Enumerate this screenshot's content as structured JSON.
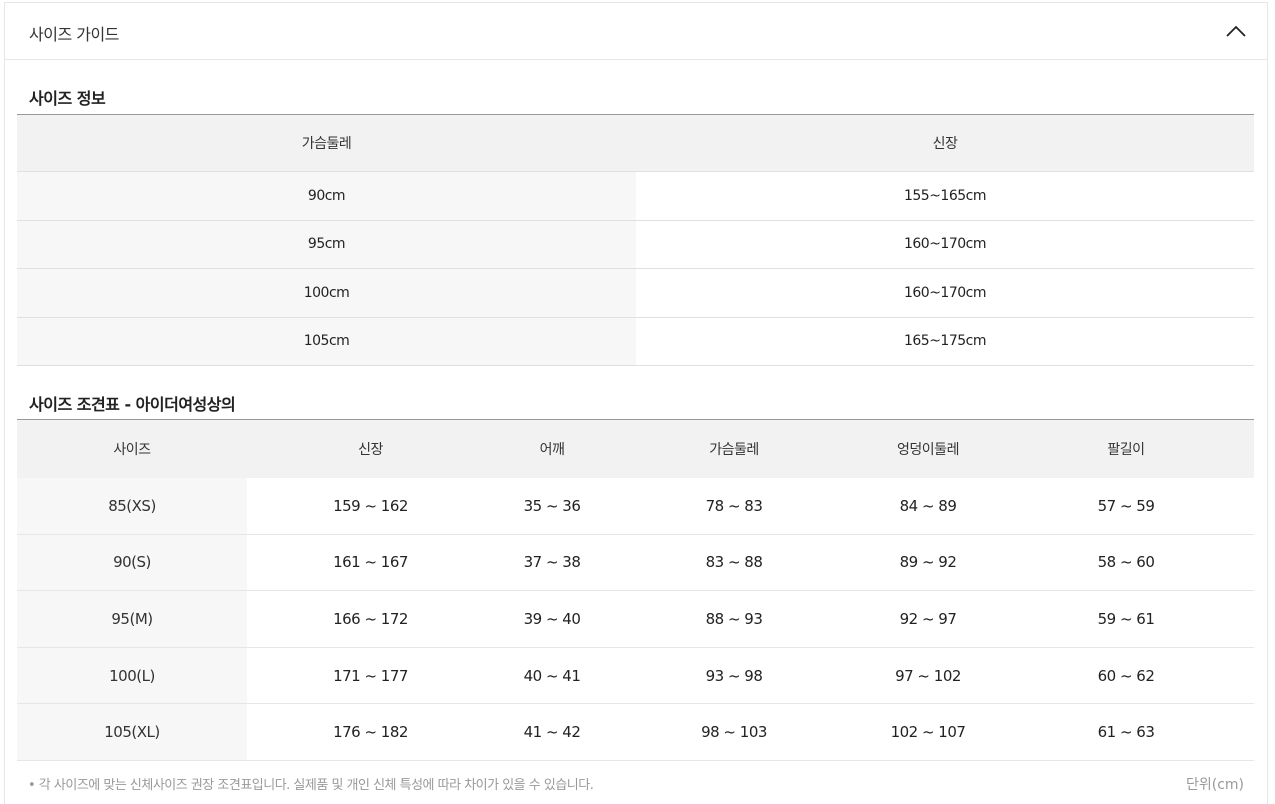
{
  "accordion": {
    "title": "사이즈 가이드"
  },
  "size_info": {
    "title": "사이즈 정보",
    "headers": [
      "가슴둘레",
      "신장"
    ],
    "rows": [
      [
        "90cm",
        "155~165cm"
      ],
      [
        "95cm",
        "160~170cm"
      ],
      [
        "100cm",
        "160~170cm"
      ],
      [
        "105cm",
        "165~175cm"
      ]
    ]
  },
  "size_chart": {
    "title": "사이즈 조견표 - 아이더여성상의",
    "headers": [
      "사이즈",
      "신장",
      "어깨",
      "가슴둘레",
      "엉덩이둘레",
      "팔길이"
    ],
    "rows": [
      [
        "85(XS)",
        "159 ~ 162",
        "35 ~ 36",
        "78 ~ 83",
        "84 ~ 89",
        "57 ~ 59"
      ],
      [
        "90(S)",
        "161 ~ 167",
        "37 ~ 38",
        "83 ~ 88",
        "89 ~ 92",
        "58 ~ 60"
      ],
      [
        "95(M)",
        "166 ~ 172",
        "39 ~ 40",
        "88 ~ 93",
        "92 ~ 97",
        "59 ~ 61"
      ],
      [
        "100(L)",
        "171 ~ 177",
        "40 ~ 41",
        "93 ~ 98",
        "97 ~ 102",
        "60 ~ 62"
      ],
      [
        "105(XL)",
        "176 ~ 182",
        "41 ~ 42",
        "98 ~ 103",
        "102 ~ 107",
        "61 ~ 63"
      ]
    ]
  },
  "footnote": "• 각 사이즈에 맞는 신체사이즈 권장 조견표입니다. 실제품 및 개인 신체 특성에 따라 차이가 있을 수 있습니다.",
  "unit": "단위(cm)",
  "icons": {
    "collapse": "chevron-up-icon"
  }
}
